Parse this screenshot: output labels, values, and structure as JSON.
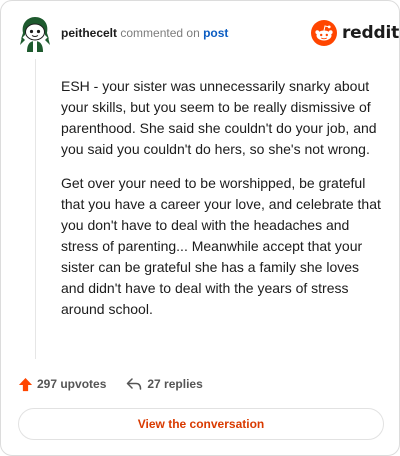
{
  "comment": {
    "username": "peithecelt",
    "action_text": "commented on",
    "post_link": "post",
    "paragraphs": [
      "ESH - your sister was unnecessarily snarky about your skills, but you seem to be really dismissive of parenthood. She said she couldn't do your job, and you said you couldn't do hers, so she's not wrong.",
      "Get over your need to be worshipped, be grateful that you have a career your love, and celebrate that you don't have to deal with the headaches and stress of parenting... Meanwhile accept that your sister can be grateful she has a family she loves and didn't have to deal with the years of stress around school."
    ]
  },
  "brand": {
    "name": "reddit",
    "color": "#ff4500"
  },
  "stats": {
    "upvotes": "297 upvotes",
    "replies": "27 replies",
    "upvote_icon": "upvote-arrow-icon",
    "reply_icon": "reply-arrow-icon"
  },
  "actions": {
    "view_conversation": "View the conversation"
  },
  "colors": {
    "link": "#0a5cc2",
    "accent": "#d93a00",
    "upvote": "#ff4500"
  }
}
